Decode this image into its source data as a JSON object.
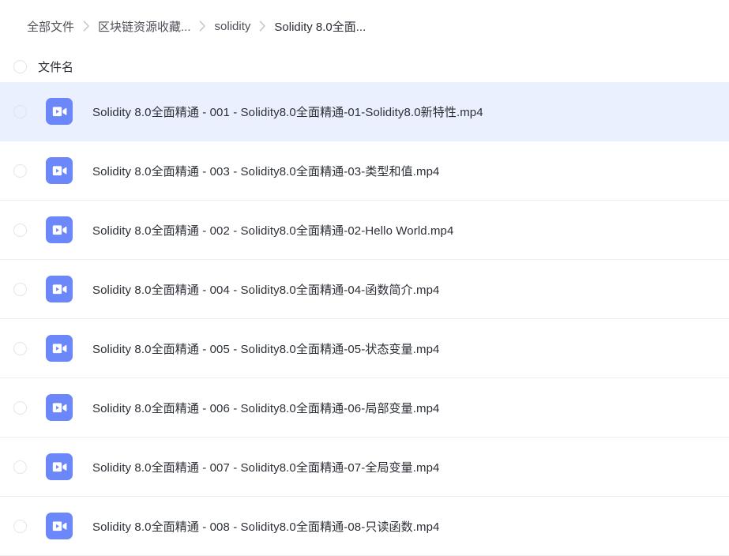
{
  "breadcrumb": {
    "items": [
      {
        "label": "全部文件"
      },
      {
        "label": "区块链资源收藏..."
      },
      {
        "label": "solidity"
      },
      {
        "label": "Solidity 8.0全面..."
      }
    ],
    "separator_icon": "chevron-right-icon"
  },
  "list_header": {
    "select_all_icon": "radio-unchecked-icon",
    "column_name": "文件名"
  },
  "colors": {
    "icon_blue": "#6b87fa",
    "row_selected_bg": "#eaf0fd",
    "row_divider": "#eceef1",
    "text_primary": "#2b2f36",
    "text_secondary": "#4c5057",
    "radio_border": "#e3e6ea"
  },
  "files": [
    {
      "name": "Solidity 8.0全面精通 - 001 - Solidity8.0全面精通-01-Solidity8.0新特性.mp4",
      "icon": "video-file-icon",
      "selected": true
    },
    {
      "name": "Solidity 8.0全面精通 - 003 - Solidity8.0全面精通-03-类型和值.mp4",
      "icon": "video-file-icon",
      "selected": false
    },
    {
      "name": "Solidity 8.0全面精通 - 002 - Solidity8.0全面精通-02-Hello World.mp4",
      "icon": "video-file-icon",
      "selected": false
    },
    {
      "name": "Solidity 8.0全面精通 - 004 - Solidity8.0全面精通-04-函数简介.mp4",
      "icon": "video-file-icon",
      "selected": false
    },
    {
      "name": "Solidity 8.0全面精通 - 005 - Solidity8.0全面精通-05-状态变量.mp4",
      "icon": "video-file-icon",
      "selected": false
    },
    {
      "name": "Solidity 8.0全面精通 - 006 - Solidity8.0全面精通-06-局部变量.mp4",
      "icon": "video-file-icon",
      "selected": false
    },
    {
      "name": "Solidity 8.0全面精通 - 007 - Solidity8.0全面精通-07-全局变量.mp4",
      "icon": "video-file-icon",
      "selected": false
    },
    {
      "name": "Solidity 8.0全面精通 - 008 - Solidity8.0全面精通-08-只读函数.mp4",
      "icon": "video-file-icon",
      "selected": false
    }
  ]
}
